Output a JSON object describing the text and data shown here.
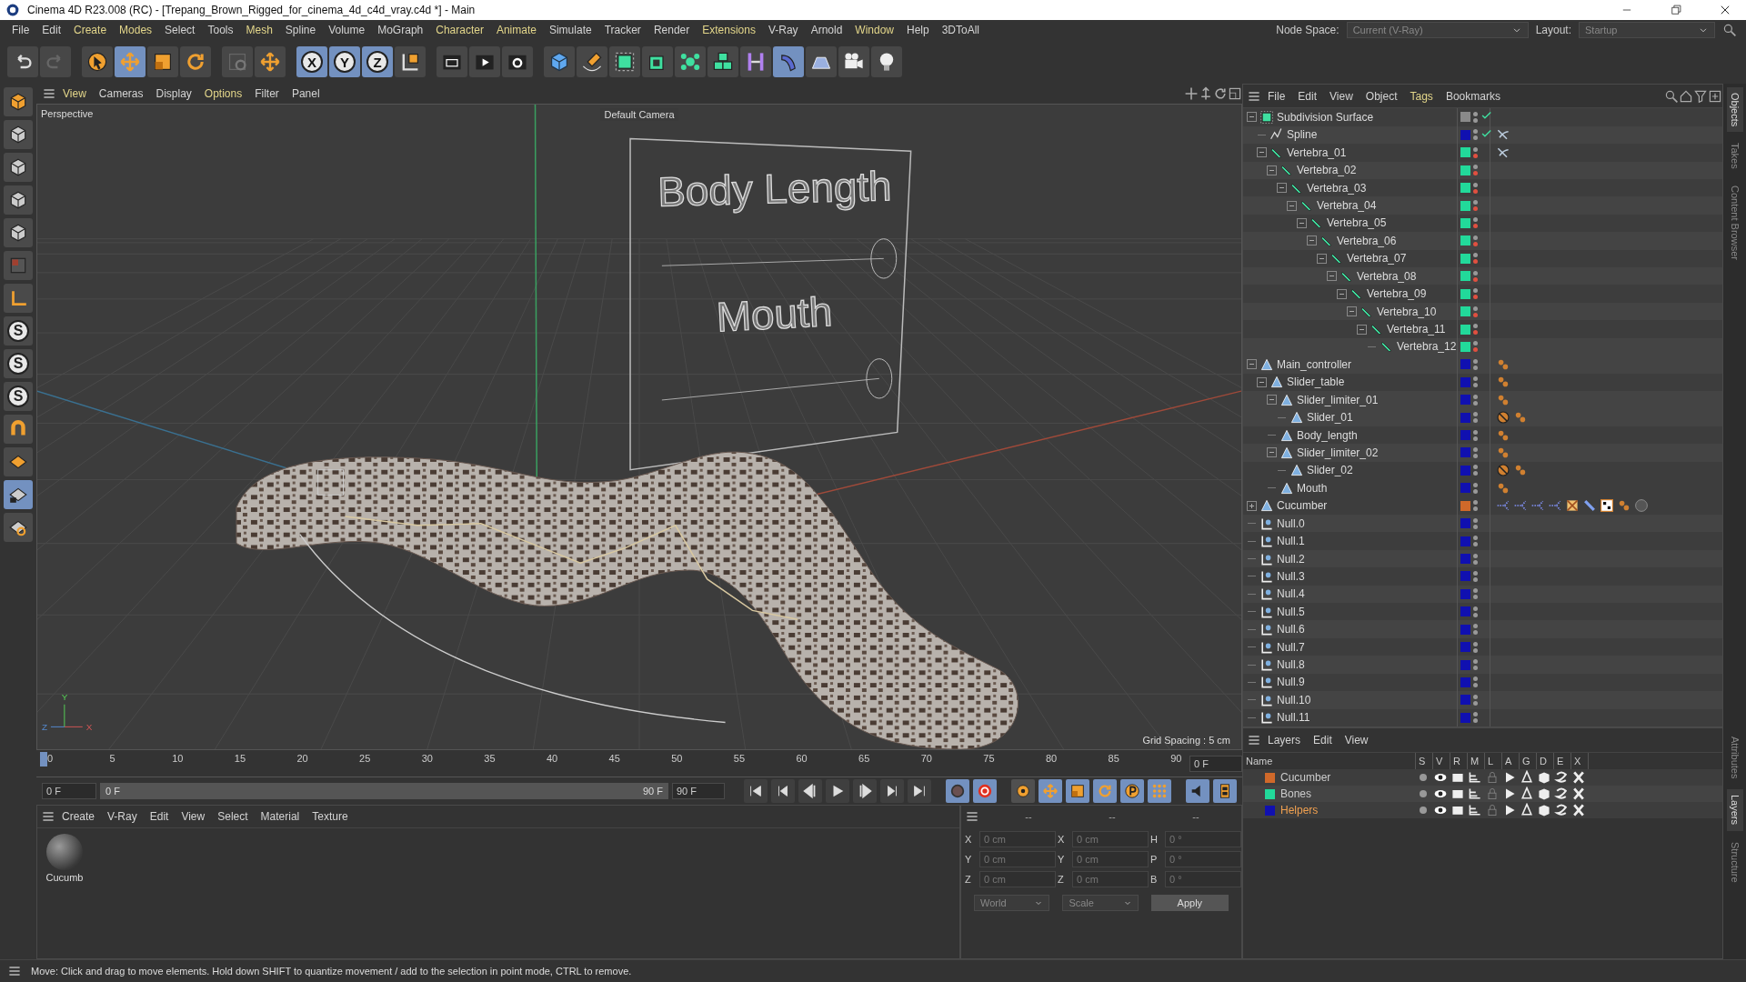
{
  "window": {
    "title": "Cinema 4D R23.008 (RC) - [Trepang_Brown_Rigged_for_cinema_4d_c4d_vray.c4d *] - Main"
  },
  "menu": [
    {
      "label": "File",
      "highlighted": false
    },
    {
      "label": "Edit",
      "highlighted": false
    },
    {
      "label": "Create",
      "highlighted": true
    },
    {
      "label": "Modes",
      "highlighted": true
    },
    {
      "label": "Select",
      "highlighted": false
    },
    {
      "label": "Tools",
      "highlighted": false
    },
    {
      "label": "Mesh",
      "highlighted": true
    },
    {
      "label": "Spline",
      "highlighted": false
    },
    {
      "label": "Volume",
      "highlighted": false
    },
    {
      "label": "MoGraph",
      "highlighted": false
    },
    {
      "label": "Character",
      "highlighted": true
    },
    {
      "label": "Animate",
      "highlighted": true
    },
    {
      "label": "Simulate",
      "highlighted": false
    },
    {
      "label": "Tracker",
      "highlighted": false
    },
    {
      "label": "Render",
      "highlighted": false
    },
    {
      "label": "Extensions",
      "highlighted": true
    },
    {
      "label": "V-Ray",
      "highlighted": false
    },
    {
      "label": "Arnold",
      "highlighted": false
    },
    {
      "label": "Window",
      "highlighted": true
    },
    {
      "label": "Help",
      "highlighted": false
    },
    {
      "label": "3DToAll",
      "highlighted": false
    }
  ],
  "node_space": {
    "label": "Node Space:",
    "value": "Current (V-Ray)"
  },
  "layout": {
    "label": "Layout:",
    "value": "Startup"
  },
  "toolbar": [
    {
      "kind": "undo",
      "active": false
    },
    {
      "kind": "redo",
      "active": false
    },
    {
      "kind": "gap"
    },
    {
      "kind": "select",
      "active": false
    },
    {
      "kind": "move",
      "active": true
    },
    {
      "kind": "scale",
      "active": false
    },
    {
      "kind": "rotate",
      "active": false
    },
    {
      "kind": "gap"
    },
    {
      "kind": "psr",
      "active": false
    },
    {
      "kind": "move-plus",
      "active": false
    },
    {
      "kind": "gap"
    },
    {
      "kind": "axis-x",
      "label": "X",
      "active": true
    },
    {
      "kind": "axis-y",
      "label": "Y",
      "active": true
    },
    {
      "kind": "axis-z",
      "label": "Z",
      "active": true
    },
    {
      "kind": "coord",
      "active": false
    },
    {
      "kind": "gap"
    },
    {
      "kind": "render-region",
      "active": false
    },
    {
      "kind": "render-view",
      "active": false
    },
    {
      "kind": "render-settings",
      "active": false
    },
    {
      "kind": "gap"
    },
    {
      "kind": "cube",
      "active": false
    },
    {
      "kind": "pen",
      "active": false
    },
    {
      "kind": "subdivision",
      "active": false
    },
    {
      "kind": "extrude",
      "active": false
    },
    {
      "kind": "cloner",
      "active": false
    },
    {
      "kind": "cubes",
      "active": false
    },
    {
      "kind": "symmetry",
      "active": false
    },
    {
      "kind": "bend",
      "active": true
    },
    {
      "kind": "floor",
      "active": false
    },
    {
      "kind": "camera",
      "active": false
    },
    {
      "kind": "light",
      "active": false
    }
  ],
  "left_tools": [
    {
      "kind": "model",
      "active": false
    },
    {
      "kind": "texture",
      "active": false
    },
    {
      "kind": "points",
      "active": false
    },
    {
      "kind": "edges",
      "active": false
    },
    {
      "kind": "polygons",
      "active": false
    },
    {
      "kind": "uv",
      "active": false
    },
    {
      "kind": "axis",
      "active": false
    },
    {
      "kind": "snap",
      "label": "S",
      "active": false
    },
    {
      "kind": "snap",
      "label": "S",
      "active": false
    },
    {
      "kind": "snap",
      "label": "S",
      "active": false
    },
    {
      "kind": "magnet",
      "active": false
    },
    {
      "kind": "workplane",
      "active": false
    },
    {
      "kind": "workplane-lock",
      "active": true
    },
    {
      "kind": "workplane-rotate",
      "active": false
    }
  ],
  "viewport": {
    "menu": [
      {
        "label": "View",
        "highlighted": true
      },
      {
        "label": "Cameras",
        "highlighted": false
      },
      {
        "label": "Display",
        "highlighted": false
      },
      {
        "label": "Options",
        "highlighted": true
      },
      {
        "label": "Filter",
        "highlighted": false
      },
      {
        "label": "Panel",
        "highlighted": false
      }
    ],
    "view_name": "Perspective",
    "camera": "Default Camera",
    "grid_spacing": "Grid Spacing : 5 cm",
    "scene_labels": [
      "Body Length",
      "Mouth"
    ],
    "axis_labels": [
      "Y",
      "Z",
      "X"
    ]
  },
  "timeline": {
    "ticks": [
      "0",
      "5",
      "10",
      "15",
      "20",
      "25",
      "30",
      "35",
      "40",
      "45",
      "50",
      "55",
      "60",
      "65",
      "70",
      "75",
      "80",
      "85",
      "90"
    ],
    "level": 0,
    "current": "0 F",
    "start": "0 F",
    "range": {
      "start": "0 F",
      "end": "90 F",
      "level": 1
    },
    "end": "90 F"
  },
  "transport": [
    {
      "kind": "first"
    },
    {
      "kind": "prev-key"
    },
    {
      "kind": "prev-frame"
    },
    {
      "kind": "play"
    },
    {
      "kind": "next-frame"
    },
    {
      "kind": "next-key"
    },
    {
      "kind": "last"
    },
    {
      "kind": "gap"
    },
    {
      "kind": "record-off",
      "active": true
    },
    {
      "kind": "record",
      "active": true
    },
    {
      "kind": "gap"
    },
    {
      "kind": "key-settings",
      "active": false
    },
    {
      "kind": "key-move",
      "active": true
    },
    {
      "kind": "key-scale",
      "active": true
    },
    {
      "kind": "key-rotate",
      "active": true
    },
    {
      "kind": "key-param",
      "active": true
    },
    {
      "kind": "key-pla",
      "active": true
    },
    {
      "kind": "gap"
    },
    {
      "kind": "sound",
      "active": true
    },
    {
      "kind": "film",
      "active": true
    }
  ],
  "materials": {
    "menu": [
      "Create",
      "V-Ray",
      "Edit",
      "View",
      "Select",
      "Material",
      "Texture"
    ],
    "items": [
      {
        "name": "Cucumb"
      }
    ]
  },
  "coordinates": {
    "headers": [
      "--",
      "--",
      "--"
    ],
    "rows": [
      {
        "axis": "X",
        "position": "0 cm",
        "size_axis": "X",
        "size": "0 cm",
        "rot_axis": "H",
        "rotation": "0 °"
      },
      {
        "axis": "Y",
        "position": "0 cm",
        "size_axis": "Y",
        "size": "0 cm",
        "rot_axis": "P",
        "rotation": "0 °"
      },
      {
        "axis": "Z",
        "position": "0 cm",
        "size_axis": "Z",
        "size": "0 cm",
        "rot_axis": "B",
        "rotation": "0 °"
      }
    ],
    "mode": "World",
    "size_mode": "Scale",
    "apply": "Apply"
  },
  "status_bar": "Move: Click and drag to move elements. Hold down SHIFT to quantize movement / add to the selection in point mode, CTRL to remove.",
  "objects_panel": {
    "menu": [
      {
        "label": "File",
        "highlighted": false
      },
      {
        "label": "Edit",
        "highlighted": false
      },
      {
        "label": "View",
        "highlighted": false
      },
      {
        "label": "Object",
        "highlighted": false
      },
      {
        "label": "Tags",
        "highlighted": true
      },
      {
        "label": "Bookmarks",
        "highlighted": false
      }
    ],
    "objects": [
      {
        "name": "Subdivision Surface",
        "kind": "subdivision",
        "color": "#8a8a8a",
        "hidden": false,
        "checked": true,
        "expanded": true,
        "children": [
          {
            "name": "Spline",
            "kind": "spline",
            "color": "#1010b0",
            "hidden": false,
            "checked": true,
            "tags": [
              {
                "kind": "spline-tag"
              }
            ]
          },
          {
            "name": "Vertebra_01",
            "kind": "bone",
            "color": "#22d99a",
            "hidden": true,
            "expanded": true,
            "tags": [
              {
                "kind": "spline-tag"
              }
            ],
            "children": [
              {
                "name": "Vertebra_02",
                "kind": "bone",
                "color": "#22d99a",
                "hidden": true,
                "expanded": true,
                "children": [
                  {
                    "name": "Vertebra_03",
                    "kind": "bone",
                    "color": "#22d99a",
                    "hidden": true,
                    "expanded": true,
                    "children": [
                      {
                        "name": "Vertebra_04",
                        "kind": "bone",
                        "color": "#22d99a",
                        "hidden": true,
                        "expanded": true,
                        "children": [
                          {
                            "name": "Vertebra_05",
                            "kind": "bone",
                            "color": "#22d99a",
                            "hidden": true,
                            "expanded": true,
                            "children": [
                              {
                                "name": "Vertebra_06",
                                "kind": "bone",
                                "color": "#22d99a",
                                "hidden": true,
                                "expanded": true,
                                "children": [
                                  {
                                    "name": "Vertebra_07",
                                    "kind": "bone",
                                    "color": "#22d99a",
                                    "hidden": true,
                                    "expanded": true,
                                    "children": [
                                      {
                                        "name": "Vertebra_08",
                                        "kind": "bone",
                                        "color": "#22d99a",
                                        "hidden": true,
                                        "expanded": true,
                                        "children": [
                                          {
                                            "name": "Vertebra_09",
                                            "kind": "bone",
                                            "color": "#22d99a",
                                            "hidden": true,
                                            "expanded": true,
                                            "children": [
                                              {
                                                "name": "Vertebra_10",
                                                "kind": "bone",
                                                "color": "#22d99a",
                                                "hidden": true,
                                                "expanded": true,
                                                "children": [
                                                  {
                                                    "name": "Vertebra_11",
                                                    "kind": "bone",
                                                    "color": "#22d99a",
                                                    "hidden": true,
                                                    "expanded": true,
                                                    "children": [
                                                      {
                                                        "name": "Vertebra_12",
                                                        "kind": "bone",
                                                        "color": "#22d99a",
                                                        "hidden": true
                                                      }
                                                    ]
                                                  }
                                                ]
                                              }
                                            ]
                                          }
                                        ]
                                      }
                                    ]
                                  }
                                ]
                              }
                            ]
                          }
                        ]
                      }
                    ]
                  }
                ]
              }
            ]
          }
        ]
      },
      {
        "name": "Main_controller",
        "kind": "null",
        "color": "#1010b0",
        "hidden": false,
        "expanded": true,
        "tags": [
          {
            "kind": "expression"
          }
        ],
        "children": [
          {
            "name": "Slider_table",
            "kind": "null",
            "color": "#1010b0",
            "hidden": false,
            "expanded": true,
            "tags": [
              {
                "kind": "expression"
              }
            ],
            "children": [
              {
                "name": "Slider_limiter_01",
                "kind": "null",
                "color": "#1010b0",
                "hidden": false,
                "expanded": true,
                "tags": [
                  {
                    "kind": "expression"
                  }
                ],
                "children": [
                  {
                    "name": "Slider_01",
                    "kind": "null",
                    "color": "#1010b0",
                    "hidden": false,
                    "tags": [
                      {
                        "kind": "protection"
                      },
                      {
                        "kind": "expression"
                      }
                    ]
                  }
                ]
              },
              {
                "name": "Body_length",
                "kind": "null",
                "color": "#1010b0",
                "hidden": false,
                "tags": [
                  {
                    "kind": "expression"
                  }
                ]
              },
              {
                "name": "Slider_limiter_02",
                "kind": "null",
                "color": "#1010b0",
                "hidden": false,
                "expanded": true,
                "tags": [
                  {
                    "kind": "expression"
                  }
                ],
                "children": [
                  {
                    "name": "Slider_02",
                    "kind": "null",
                    "color": "#1010b0",
                    "hidden": false,
                    "tags": [
                      {
                        "kind": "protection"
                      },
                      {
                        "kind": "expression"
                      }
                    ]
                  }
                ]
              },
              {
                "name": "Mouth",
                "kind": "null",
                "color": "#1010b0",
                "hidden": false,
                "tags": [
                  {
                    "kind": "expression"
                  }
                ]
              }
            ]
          }
        ]
      },
      {
        "name": "Cucumber",
        "kind": "null",
        "color": "#d0692a",
        "hidden": false,
        "expanded": false,
        "tags": [
          {
            "kind": "ik"
          },
          {
            "kind": "ik"
          },
          {
            "kind": "ik"
          },
          {
            "kind": "ik"
          },
          {
            "kind": "weight"
          },
          {
            "kind": "skin"
          },
          {
            "kind": "uvw"
          },
          {
            "kind": "expression"
          },
          {
            "kind": "material"
          }
        ]
      },
      {
        "name": "Null.0",
        "kind": "axis-null",
        "color": "#1010b0",
        "hidden": false
      },
      {
        "name": "Null.1",
        "kind": "axis-null",
        "color": "#1010b0",
        "hidden": false
      },
      {
        "name": "Null.2",
        "kind": "axis-null",
        "color": "#1010b0",
        "hidden": false
      },
      {
        "name": "Null.3",
        "kind": "axis-null",
        "color": "#1010b0",
        "hidden": false
      },
      {
        "name": "Null.4",
        "kind": "axis-null",
        "color": "#1010b0",
        "hidden": false
      },
      {
        "name": "Null.5",
        "kind": "axis-null",
        "color": "#1010b0",
        "hidden": false
      },
      {
        "name": "Null.6",
        "kind": "axis-null",
        "color": "#1010b0",
        "hidden": false
      },
      {
        "name": "Null.7",
        "kind": "axis-null",
        "color": "#1010b0",
        "hidden": false
      },
      {
        "name": "Null.8",
        "kind": "axis-null",
        "color": "#1010b0",
        "hidden": false
      },
      {
        "name": "Null.9",
        "kind": "axis-null",
        "color": "#1010b0",
        "hidden": false
      },
      {
        "name": "Null.10",
        "kind": "axis-null",
        "color": "#1010b0",
        "hidden": false
      },
      {
        "name": "Null.11",
        "kind": "axis-null",
        "color": "#1010b0",
        "hidden": false
      }
    ]
  },
  "layers_panel": {
    "menu": [
      "Layers",
      "Edit",
      "View"
    ],
    "columns": [
      "Name",
      "S",
      "V",
      "R",
      "M",
      "L",
      "A",
      "G",
      "D",
      "E",
      "X"
    ],
    "layers": [
      {
        "name": "Cucumber",
        "color": "#d0692a",
        "selected": false
      },
      {
        "name": "Bones",
        "color": "#22d99a",
        "selected": false
      },
      {
        "name": "Helpers",
        "color": "#1010b0",
        "selected": true
      }
    ]
  },
  "side_tabs_top": [
    {
      "label": "Objects",
      "selected": true
    },
    {
      "label": "Takes",
      "selected": false
    },
    {
      "label": "Content Browser",
      "selected": false
    }
  ],
  "side_tabs_bottom": [
    {
      "label": "Attributes",
      "selected": false
    },
    {
      "label": "Layers",
      "selected": true
    },
    {
      "label": "Structure",
      "selected": false
    }
  ]
}
